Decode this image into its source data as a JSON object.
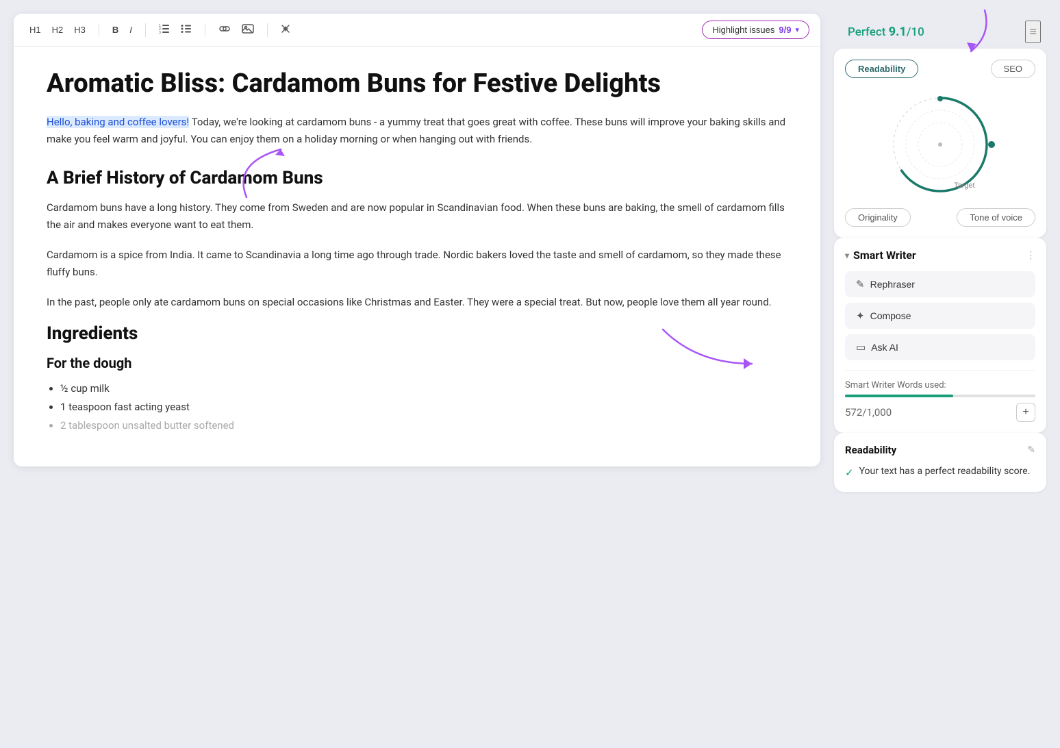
{
  "toolbar": {
    "h1_label": "H1",
    "h2_label": "H2",
    "h3_label": "H3",
    "bold_label": "B",
    "italic_label": "I",
    "highlight_label": "Highlight issues",
    "highlight_count": "9/9",
    "chevron": "▾"
  },
  "editor": {
    "title": "Aromatic Bliss: Cardamom Buns for Festive Delights",
    "intro_highlighted": "Hello, baking and coffee lovers!",
    "intro_rest": " Today, we're looking at cardamom buns - a yummy treat that goes great with coffee. These buns will improve your baking skills and make you feel warm and joyful. You can enjoy them on a holiday morning or when hanging out with friends.",
    "h2_history": "A Brief History of Cardamom Buns",
    "para1": "Cardamom buns have a long history. They come from Sweden and are now popular in Scandinavian food. When these buns are baking, the smell of cardamom fills the air and makes everyone want to eat them.",
    "para2": "Cardamom is a spice from India. It came to Scandinavia a long time ago through trade. Nordic bakers loved the taste and smell of cardamom, so they made these fluffy buns.",
    "para3": "In the past, people only ate cardamom buns on special occasions like Christmas and Easter. They were a special treat. But now, people love them all year round.",
    "h2_ingredients": "Ingredients",
    "h3_dough": "For the dough",
    "list_items": [
      {
        "text": "½ cup milk",
        "faded": false
      },
      {
        "text": "1 teaspoon fast acting yeast",
        "faded": false
      },
      {
        "text": "2 tablespoon unsalted butter softened",
        "faded": true
      }
    ]
  },
  "score": {
    "label": "Perfect",
    "value": "9.1",
    "max": "/10",
    "tab_readability": "Readability",
    "tab_seo": "SEO",
    "tab_originality": "Originality",
    "tab_tone": "Tone of voice",
    "target_label": "Target",
    "circle_color": "#1a7a6a",
    "circle_radius": 70,
    "circle_progress": 0.91
  },
  "smart_writer": {
    "title": "Smart Writer",
    "btn_rephraser": "Rephraser",
    "btn_compose": "Compose",
    "btn_ask_ai": "Ask AI",
    "words_label": "Smart Writer Words used:",
    "words_used": "572",
    "words_total": "1,000",
    "words_percent": 57.2
  },
  "readability": {
    "title": "Readability",
    "check_text": "Your text has a perfect readability score."
  },
  "icons": {
    "menu": "≡",
    "collapse": "▾",
    "info": "⋮",
    "edit": "✎",
    "check": "✓",
    "rephraser_icon": "✎",
    "compose_icon": "✦",
    "ask_ai_icon": "▭"
  }
}
